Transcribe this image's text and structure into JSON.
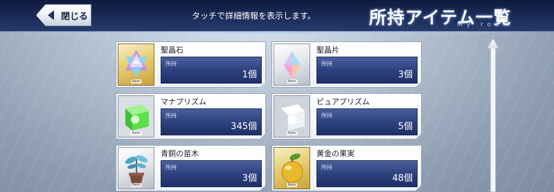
{
  "header": {
    "close_label": "閉じる",
    "hint": "タッチで詳細情報を表示します。",
    "title": "所持アイテム一覧",
    "subtitle": "My room"
  },
  "qty_label": "所持",
  "items": [
    {
      "name": "聖晶石",
      "quantity": "1個",
      "icon": "saint-quartz-icon",
      "frame": "gold",
      "tag": "Item"
    },
    {
      "name": "聖晶片",
      "quantity": "3個",
      "icon": "quartz-fragment-icon",
      "frame": "silver",
      "tag": "Item"
    },
    {
      "name": "マナプリズム",
      "quantity": "345個",
      "icon": "mana-prism-icon",
      "frame": "silver",
      "tag": "Item"
    },
    {
      "name": "ピュアプリズム",
      "quantity": "5個",
      "icon": "pure-prism-icon",
      "frame": "silver",
      "tag": "Item"
    },
    {
      "name": "青銅の苗木",
      "quantity": "3個",
      "icon": "bronze-sapling-icon",
      "frame": "silver",
      "tag": "Item"
    },
    {
      "name": "黄金の果実",
      "quantity": "48個",
      "icon": "golden-fruit-icon",
      "frame": "gold",
      "tag": "Item"
    }
  ],
  "colors": {
    "header_bg": "#1c2d5b",
    "qty_bar": "#2d427f"
  }
}
